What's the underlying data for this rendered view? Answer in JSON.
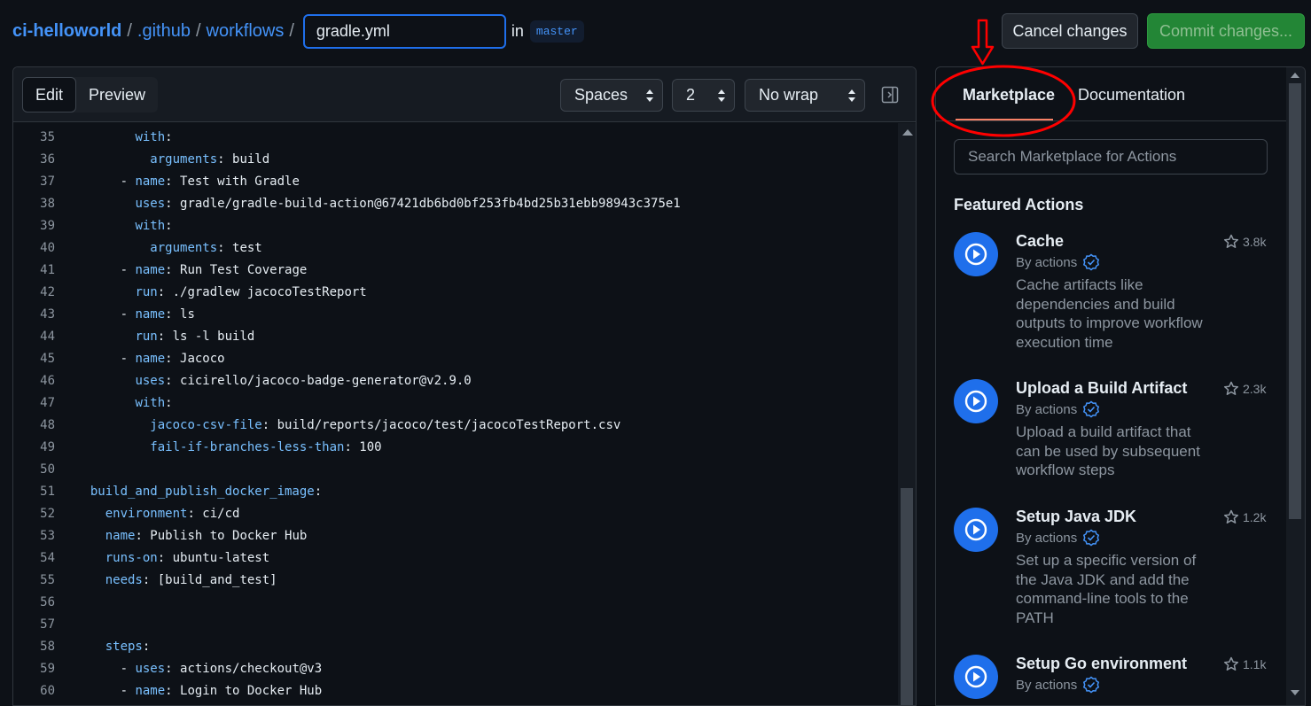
{
  "breadcrumb": {
    "repo": "ci-helloworld",
    "folder1": ".github",
    "folder2": "workflows",
    "separator": "/",
    "filename": "gradle.yml",
    "in_label": "in",
    "branch": "master"
  },
  "header_buttons": {
    "cancel": "Cancel changes",
    "commit": "Commit changes..."
  },
  "editor_toolbar": {
    "edit_tab": "Edit",
    "preview_tab": "Preview",
    "indent_mode": "Spaces",
    "indent_size": "2",
    "wrap_mode": "No wrap"
  },
  "code_lines": [
    {
      "n": "35",
      "indent": "        ",
      "dash": "",
      "key": "with",
      "rest": ":"
    },
    {
      "n": "36",
      "indent": "          ",
      "dash": "",
      "key": "arguments",
      "rest": ": build"
    },
    {
      "n": "37",
      "indent": "      ",
      "dash": "- ",
      "key": "name",
      "rest": ": Test with Gradle"
    },
    {
      "n": "38",
      "indent": "        ",
      "dash": "",
      "key": "uses",
      "rest": ": gradle/gradle-build-action@67421db6bd0bf253fb4bd25b31ebb98943c375e1"
    },
    {
      "n": "39",
      "indent": "        ",
      "dash": "",
      "key": "with",
      "rest": ":"
    },
    {
      "n": "40",
      "indent": "          ",
      "dash": "",
      "key": "arguments",
      "rest": ": test"
    },
    {
      "n": "41",
      "indent": "      ",
      "dash": "- ",
      "key": "name",
      "rest": ": Run Test Coverage"
    },
    {
      "n": "42",
      "indent": "        ",
      "dash": "",
      "key": "run",
      "rest": ": ./gradlew jacocoTestReport"
    },
    {
      "n": "43",
      "indent": "      ",
      "dash": "- ",
      "key": "name",
      "rest": ": ls"
    },
    {
      "n": "44",
      "indent": "        ",
      "dash": "",
      "key": "run",
      "rest": ": ls -l build"
    },
    {
      "n": "45",
      "indent": "      ",
      "dash": "- ",
      "key": "name",
      "rest": ": Jacoco"
    },
    {
      "n": "46",
      "indent": "        ",
      "dash": "",
      "key": "uses",
      "rest": ": cicirello/jacoco-badge-generator@v2.9.0"
    },
    {
      "n": "47",
      "indent": "        ",
      "dash": "",
      "key": "with",
      "rest": ":"
    },
    {
      "n": "48",
      "indent": "          ",
      "dash": "",
      "key": "jacoco-csv-file",
      "rest": ": build/reports/jacoco/test/jacocoTestReport.csv"
    },
    {
      "n": "49",
      "indent": "          ",
      "dash": "",
      "key": "fail-if-branches-less-than",
      "rest": ": 100"
    },
    {
      "n": "50",
      "indent": "",
      "dash": "",
      "key": "",
      "rest": ""
    },
    {
      "n": "51",
      "indent": "  ",
      "dash": "",
      "key": "build_and_publish_docker_image",
      "rest": ":"
    },
    {
      "n": "52",
      "indent": "    ",
      "dash": "",
      "key": "environment",
      "rest": ": ci/cd"
    },
    {
      "n": "53",
      "indent": "    ",
      "dash": "",
      "key": "name",
      "rest": ": Publish to Docker Hub"
    },
    {
      "n": "54",
      "indent": "    ",
      "dash": "",
      "key": "runs-on",
      "rest": ": ubuntu-latest"
    },
    {
      "n": "55",
      "indent": "    ",
      "dash": "",
      "key": "needs",
      "rest": ": [build_and_test]"
    },
    {
      "n": "56",
      "indent": "",
      "dash": "",
      "key": "",
      "rest": ""
    },
    {
      "n": "57",
      "indent": "",
      "dash": "",
      "key": "",
      "rest": ""
    },
    {
      "n": "58",
      "indent": "    ",
      "dash": "",
      "key": "steps",
      "rest": ":"
    },
    {
      "n": "59",
      "indent": "      ",
      "dash": "- ",
      "key": "uses",
      "rest": ": actions/checkout@v3"
    },
    {
      "n": "60",
      "indent": "      ",
      "dash": "- ",
      "key": "name",
      "rest": ": Login to Docker Hub"
    }
  ],
  "marketplace": {
    "tab_marketplace": "Marketplace",
    "tab_documentation": "Documentation",
    "search_placeholder": "Search Marketplace for Actions",
    "featured_heading": "Featured Actions",
    "actions": [
      {
        "title": "Cache",
        "by": "By actions",
        "stars": "3.8k",
        "description": "Cache artifacts like dependencies and build outputs to improve workflow execution time"
      },
      {
        "title": "Upload a Build Artifact",
        "by": "By actions",
        "stars": "2.3k",
        "description": "Upload a build artifact that can be used by subsequent workflow steps"
      },
      {
        "title": "Setup Java JDK",
        "by": "By actions",
        "stars": "1.2k",
        "description": "Set up a specific version of the Java JDK and add the command-line tools to the PATH"
      },
      {
        "title": "Setup Go environment",
        "by": "By actions",
        "stars": "1.1k",
        "description": ""
      }
    ]
  },
  "colors": {
    "background": "#0d1117",
    "link": "#4493f8",
    "yaml_key": "#79c0ff",
    "commit_green": "#238636",
    "annotation_red": "#ff0000",
    "tab_underline": "#f78166"
  },
  "icons": [
    "chevron-updown-icon",
    "panel-toggle-icon",
    "play-icon",
    "verified-icon",
    "star-icon",
    "arrow-down-annotation",
    "ellipse-annotation"
  ]
}
